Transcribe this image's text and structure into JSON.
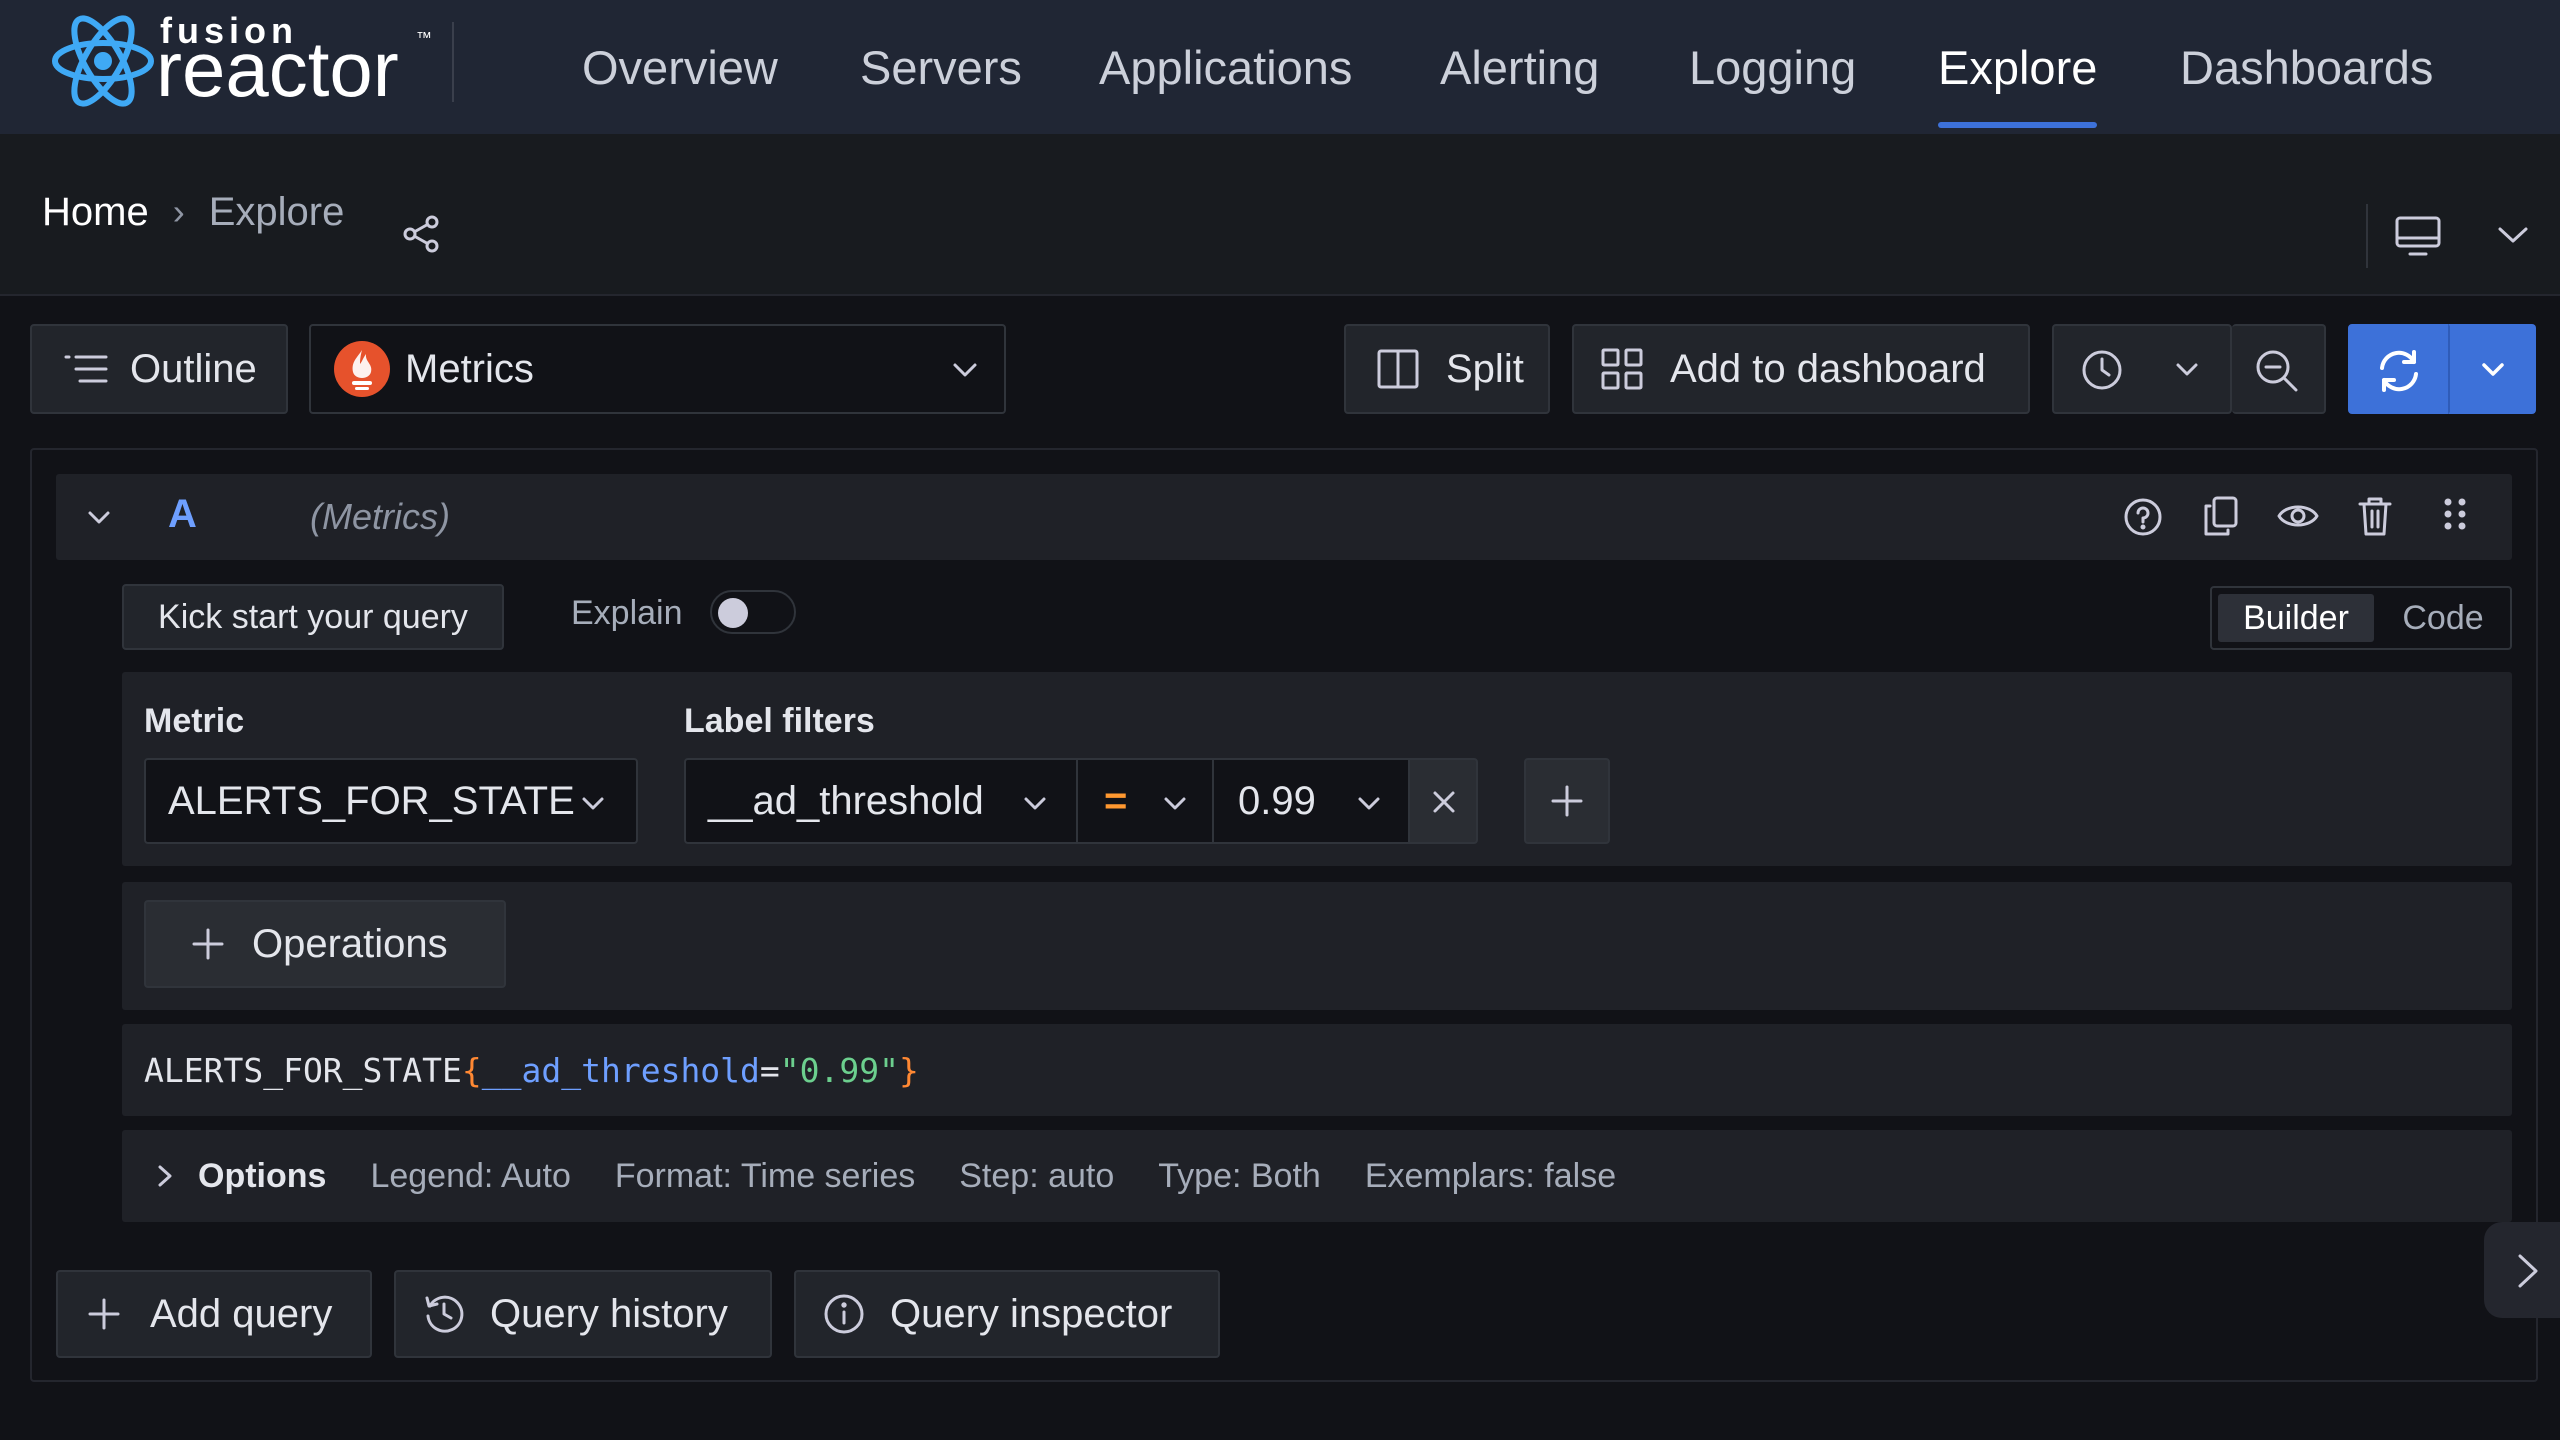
{
  "brand": {
    "line1": "fusion",
    "line2": "reactor",
    "tm": "™"
  },
  "nav": {
    "items": [
      {
        "label": "Overview"
      },
      {
        "label": "Servers"
      },
      {
        "label": "Applications"
      },
      {
        "label": "Alerting"
      },
      {
        "label": "Logging"
      },
      {
        "label": "Explore",
        "active": true
      },
      {
        "label": "Dashboards"
      }
    ]
  },
  "breadcrumb": {
    "home": "Home",
    "separator": "›",
    "current": "Explore"
  },
  "toolbar": {
    "outline_label": "Outline",
    "datasource": "Metrics",
    "split_label": "Split",
    "add_to_dashboard_label": "Add to dashboard"
  },
  "query": {
    "ref_id": "A",
    "datasource_hint": "(Metrics)",
    "kickstart_label": "Kick start your query",
    "explain_label": "Explain",
    "explain_on": false,
    "mode_builder": "Builder",
    "mode_code": "Code",
    "active_mode": "Builder",
    "metric_label": "Metric",
    "metric_value": "ALERTS_FOR_STATE",
    "label_filters_label": "Label filters",
    "filter_key": "__ad_threshold",
    "filter_op": "=",
    "filter_value": "0.99",
    "operations_label": "Operations",
    "preview": {
      "metric": "ALERTS_FOR_STATE",
      "open_brace": "{",
      "label": "__ad_threshold",
      "eq": "=",
      "value": "\"0.99\"",
      "close_brace": "}"
    },
    "options": {
      "label": "Options",
      "legend": "Legend: Auto",
      "format": "Format: Time series",
      "step": "Step: auto",
      "type": "Type: Both",
      "exemplars": "Exemplars: false"
    }
  },
  "footer": {
    "add_query_label": "Add query",
    "query_history_label": "Query history",
    "query_inspector_label": "Query inspector"
  },
  "colors": {
    "accent": "#3d71d9",
    "nav_bg": "#202634",
    "page_bg": "#111217",
    "panel_bg": "#181b1f",
    "label_key": "#6e9fff",
    "label_value": "#6ccf8e",
    "brace": "#ff8833",
    "operator": "#ff9830"
  }
}
